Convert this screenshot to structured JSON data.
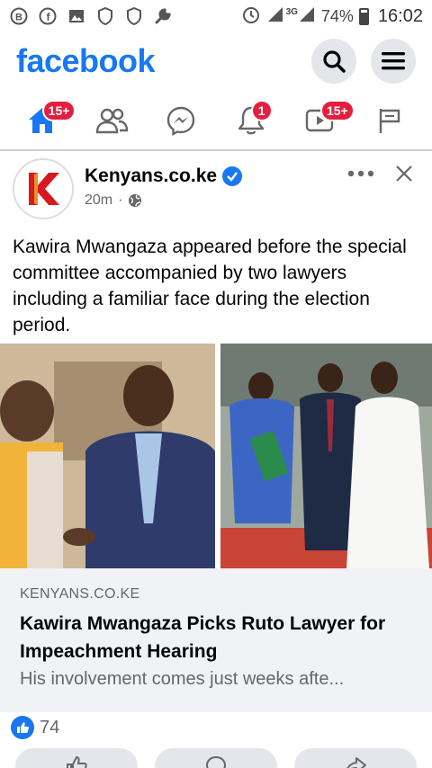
{
  "status_bar": {
    "network": "3G",
    "battery": "74%",
    "battery_level": 0.74,
    "time": "16:02",
    "icons": [
      "b-circle-icon",
      "facebook-icon",
      "image-icon",
      "shield-icon",
      "shield-icon",
      "wrench-icon",
      "alarm-icon",
      "signal-icon",
      "signal-icon",
      "battery-icon"
    ]
  },
  "header": {
    "logo": "facebook",
    "brand_color": "#1877f2"
  },
  "nav": {
    "tabs": [
      {
        "name": "home",
        "badge": "15+"
      },
      {
        "name": "friends",
        "badge": ""
      },
      {
        "name": "messenger",
        "badge": ""
      },
      {
        "name": "notifications",
        "badge": "1"
      },
      {
        "name": "watch",
        "badge": "15+"
      },
      {
        "name": "pages",
        "badge": ""
      }
    ]
  },
  "post": {
    "author": "Kenyans.co.ke",
    "time": "20m",
    "text": "Kawira Mwangaza appeared before the special committee accompanied by two lawyers including a familiar face during the election period.",
    "link": {
      "domain": "KENYANS.CO.KE",
      "title": "Kawira Mwangaza Picks Ruto Lawyer for Impeachment Hearing",
      "description": "His involvement comes just weeks afte..."
    },
    "reactions": {
      "count": "74"
    }
  }
}
